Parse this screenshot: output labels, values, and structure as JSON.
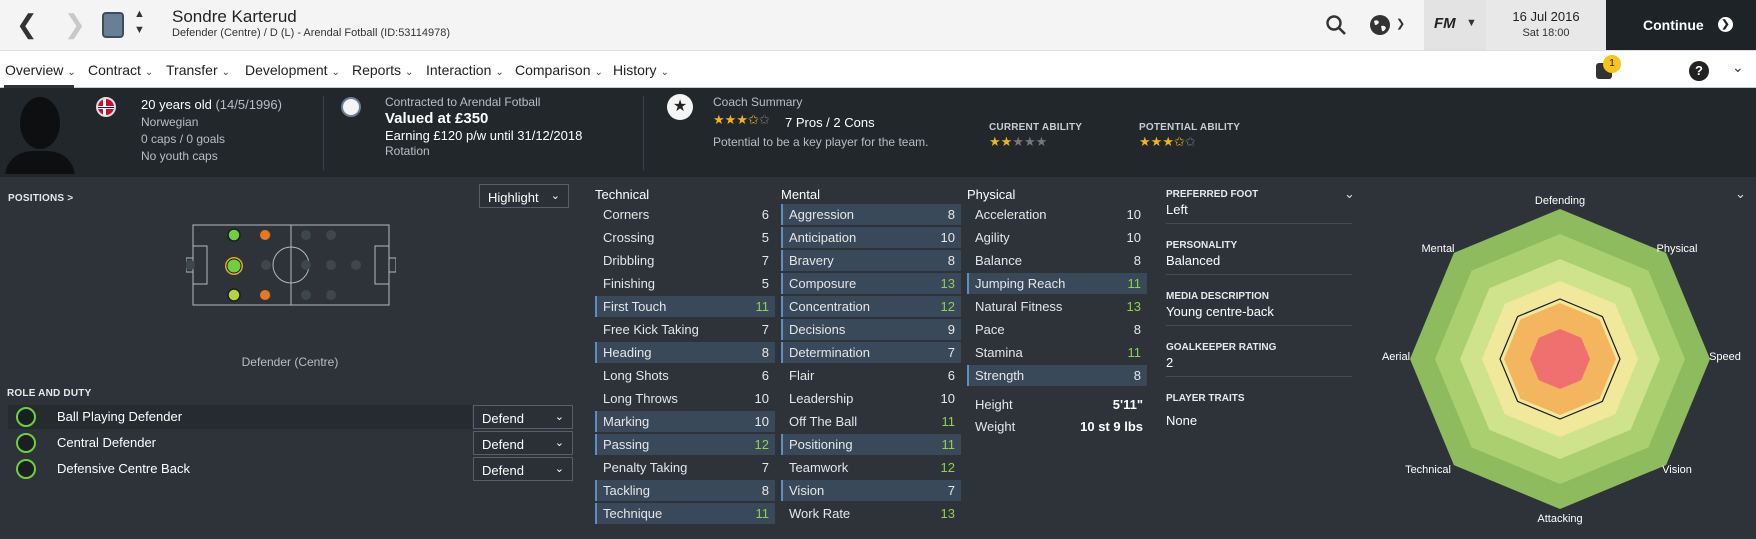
{
  "header": {
    "player_name": "Sondre Karterud",
    "player_subtitle": "Defender (Centre) / D (L) - Arendal Fotball (ID:53114978)",
    "date": "16 Jul 2016",
    "time": "Sat 18:00",
    "continue_label": "Continue",
    "fm_label": "FM"
  },
  "nav": {
    "items": [
      "Overview",
      "Contract",
      "Transfer",
      "Development",
      "Reports",
      "Interaction",
      "Comparison",
      "History"
    ],
    "notification_count": "1"
  },
  "info": {
    "age": "20 years old",
    "dob": "(14/5/1996)",
    "nationality": "Norwegian",
    "caps": "0 caps / 0 goals",
    "youth_caps": "No youth caps",
    "contracted_to": "Contracted to Arendal Fotball",
    "valued": "Valued at £350",
    "earning": "Earning £120 p/w until 31/12/2018",
    "status": "Rotation",
    "coach_summary_label": "Coach Summary",
    "pros_cons": "7 Pros / 2 Cons",
    "potential_text": "Potential to be a key player for the team.",
    "current_ability_label": "CURRENT ABILITY",
    "potential_ability_label": "POTENTIAL ABILITY",
    "coach_stars": 3.5,
    "current_ability_stars": 2,
    "potential_ability_stars": 3.5
  },
  "positions": {
    "label": "POSITIONS >",
    "highlight": "Highlight",
    "position_caption": "Defender (Centre)"
  },
  "roles": {
    "label": "ROLE AND DUTY",
    "items": [
      {
        "role": "Ball Playing Defender",
        "duty": "Defend"
      },
      {
        "role": "Central Defender",
        "duty": "Defend"
      },
      {
        "role": "Defensive Centre Back",
        "duty": "Defend"
      }
    ]
  },
  "attributes": {
    "technical_label": "Technical",
    "mental_label": "Mental",
    "physical_label": "Physical",
    "technical": [
      {
        "name": "Corners",
        "value": "6",
        "hl": false
      },
      {
        "name": "Crossing",
        "value": "5",
        "hl": false
      },
      {
        "name": "Dribbling",
        "value": "7",
        "hl": false
      },
      {
        "name": "Finishing",
        "value": "5",
        "hl": false
      },
      {
        "name": "First Touch",
        "value": "11",
        "hl": true
      },
      {
        "name": "Free Kick Taking",
        "value": "7",
        "hl": false
      },
      {
        "name": "Heading",
        "value": "8",
        "hl": true
      },
      {
        "name": "Long Shots",
        "value": "6",
        "hl": false
      },
      {
        "name": "Long Throws",
        "value": "10",
        "hl": false
      },
      {
        "name": "Marking",
        "value": "10",
        "hl": true
      },
      {
        "name": "Passing",
        "value": "12",
        "hl": true
      },
      {
        "name": "Penalty Taking",
        "value": "7",
        "hl": false
      },
      {
        "name": "Tackling",
        "value": "8",
        "hl": true
      },
      {
        "name": "Technique",
        "value": "11",
        "hl": true
      }
    ],
    "mental": [
      {
        "name": "Aggression",
        "value": "8",
        "hl": true
      },
      {
        "name": "Anticipation",
        "value": "10",
        "hl": true
      },
      {
        "name": "Bravery",
        "value": "8",
        "hl": true
      },
      {
        "name": "Composure",
        "value": "13",
        "hl": true
      },
      {
        "name": "Concentration",
        "value": "12",
        "hl": true
      },
      {
        "name": "Decisions",
        "value": "9",
        "hl": true
      },
      {
        "name": "Determination",
        "value": "7",
        "hl": true
      },
      {
        "name": "Flair",
        "value": "6",
        "hl": false
      },
      {
        "name": "Leadership",
        "value": "10",
        "hl": false
      },
      {
        "name": "Off The Ball",
        "value": "11",
        "hl": false
      },
      {
        "name": "Positioning",
        "value": "11",
        "hl": true
      },
      {
        "name": "Teamwork",
        "value": "12",
        "hl": false
      },
      {
        "name": "Vision",
        "value": "7",
        "hl": true
      },
      {
        "name": "Work Rate",
        "value": "13",
        "hl": false
      }
    ],
    "physical": [
      {
        "name": "Acceleration",
        "value": "10",
        "hl": false
      },
      {
        "name": "Agility",
        "value": "10",
        "hl": false
      },
      {
        "name": "Balance",
        "value": "8",
        "hl": false
      },
      {
        "name": "Jumping Reach",
        "value": "11",
        "hl": true
      },
      {
        "name": "Natural Fitness",
        "value": "13",
        "hl": false
      },
      {
        "name": "Pace",
        "value": "8",
        "hl": false
      },
      {
        "name": "Stamina",
        "value": "11",
        "hl": false
      },
      {
        "name": "Strength",
        "value": "8",
        "hl": true
      }
    ],
    "height_label": "Height",
    "height": "5'11\"",
    "weight_label": "Weight",
    "weight": "10 st 9 lbs"
  },
  "traits": {
    "preferred_foot_label": "PREFERRED FOOT",
    "preferred_foot": "Left",
    "personality_label": "PERSONALITY",
    "personality": "Balanced",
    "media_label": "MEDIA DESCRIPTION",
    "media": "Young centre-back",
    "gk_label": "GOALKEEPER RATING",
    "gk": "2",
    "player_traits_label": "PLAYER TRAITS",
    "player_traits": "None"
  },
  "radar": {
    "labels": [
      "Defending",
      "Physical",
      "Speed",
      "Vision",
      "Attacking",
      "Technical",
      "Aerial",
      "Mental"
    ]
  },
  "colors": {
    "accent_green": "#8fd14f",
    "highlight_row": "#39495a",
    "star": "#f2b31b"
  }
}
